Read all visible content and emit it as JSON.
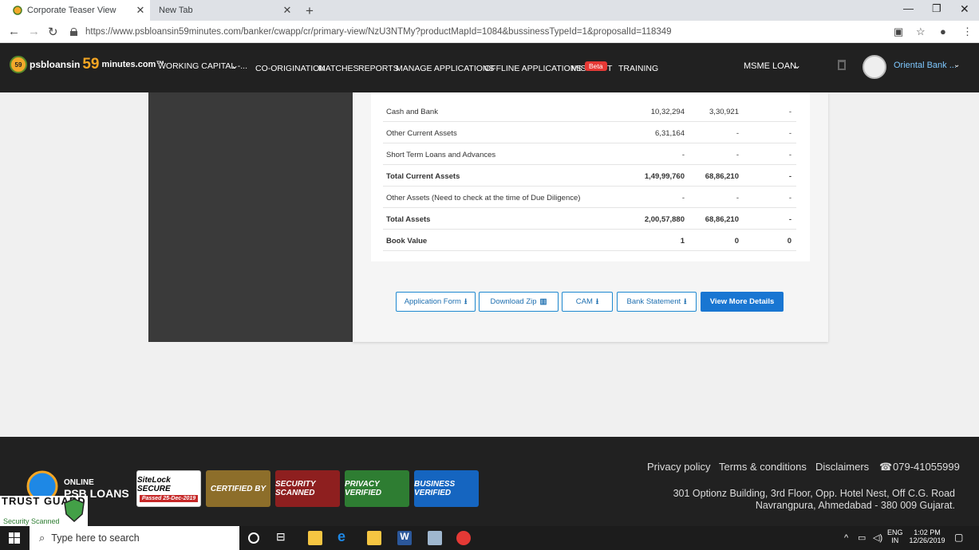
{
  "browser": {
    "tabs": [
      {
        "title": "Corporate Teaser View",
        "active": true
      },
      {
        "title": "New Tab",
        "active": false
      }
    ],
    "url": "https://www.psbloansin59minutes.com/banker/cwapp/cr/primary-view/NzU3NTMy?productMapId=1084&bussinessTypeId=1&proposalId=118349"
  },
  "header": {
    "logo_part1": "psbloansin",
    "logo_59": "59",
    "logo_part2": "minutes.com™",
    "nav": [
      "WORKING CAPITAL -...",
      "CO-ORIGINATION",
      "MATCHES",
      "REPORTS",
      "MANAGE APPLICATIONS",
      "OFFLINE APPLICATIONS",
      "MIS",
      "T",
      "TRAINING"
    ],
    "beta": "Beta",
    "loan_type": "MSME LOAN",
    "bank_name": "Oriental Bank ..."
  },
  "table": {
    "rows": [
      {
        "label": "Cash and Bank",
        "v1": "10,32,294",
        "v2": "3,30,921",
        "v3": "-",
        "bold": false
      },
      {
        "label": "Other Current Assets",
        "v1": "6,31,164",
        "v2": "-",
        "v3": "-",
        "bold": false
      },
      {
        "label": "Short Term Loans and Advances",
        "v1": "-",
        "v2": "-",
        "v3": "-",
        "bold": false
      },
      {
        "label": "Total Current Assets",
        "v1": "1,49,99,760",
        "v2": "68,86,210",
        "v3": "-",
        "bold": true
      },
      {
        "label": "Other Assets (Need to check at the time of Due Diligence)",
        "v1": "-",
        "v2": "-",
        "v3": "-",
        "bold": false
      },
      {
        "label": "Total Assets",
        "v1": "2,00,57,880",
        "v2": "68,86,210",
        "v3": "-",
        "bold": true
      },
      {
        "label": "Book Value",
        "v1": "1",
        "v2": "0",
        "v3": "0",
        "bold": true
      }
    ]
  },
  "actions": {
    "application_form": "Application Form",
    "download_zip": "Download Zip",
    "cam": "CAM",
    "bank_statement": "Bank Statement",
    "view_more": "View More Details"
  },
  "footer": {
    "privacy": "Privacy policy",
    "terms": "Terms & conditions",
    "disclaimers": "Disclaimers",
    "phone": "079-41055999",
    "address1": "301 Optionz Building, 3rd Floor, Opp. Hotel Nest, Off C.G. Road",
    "address2": "Navrangpura, Ahmedabad - 380 009 Gujarat.",
    "online": "ONLINE",
    "psb": "PSB LOANS",
    "badges": [
      "SiteLock SECURE",
      "CERTIFIED BY",
      "SECURITY SCANNED",
      "PRIVACY VERIFIED",
      "BUSINESS VERIFIED"
    ],
    "sitelock_date": "Passed 25-Dec-2019",
    "trustguard": "TRUST GUARD",
    "trustguard_sub": "Security Scanned"
  },
  "taskbar": {
    "search_placeholder": "Type here to search",
    "lang1": "ENG",
    "lang2": "IN",
    "time": "1:02 PM",
    "date": "12/26/2019"
  }
}
